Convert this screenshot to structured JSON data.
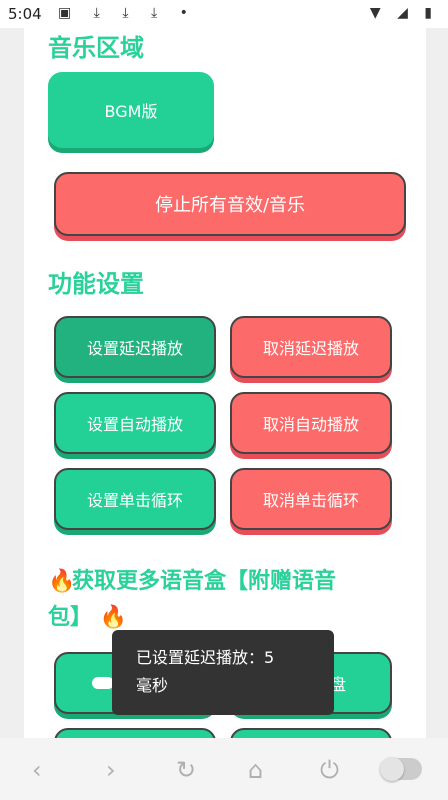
{
  "status_bar": {
    "time": "5:04",
    "left_icons": "▣ ⤓ ⤓ ⤓ •",
    "right_icons": "▼ ◢ ▮"
  },
  "music_section": {
    "title": "音乐区域",
    "bgm_button": "BGM版",
    "stop_button": "停止所有音效/音乐"
  },
  "settings_section": {
    "title": "功能设置",
    "buttons": [
      "设置延迟播放",
      "取消延迟播放",
      "设置自动播放",
      "取消自动播放",
      "设置单击循环",
      "取消单击循环"
    ]
  },
  "more_section": {
    "title_line1": "获取更多语音盒【附赠语音",
    "title_line2": "包】",
    "fire_icon": "🔥",
    "partial_button_right": "盘"
  },
  "toast": {
    "line1": "已设置延迟播放：5",
    "line2": "毫秒"
  },
  "nav": {
    "back_icon": "‹",
    "forward_icon": "›",
    "refresh_icon": "↻",
    "home_icon": "⌂",
    "power_icon": "⏻"
  },
  "colors": {
    "accent": "#2bd19a",
    "green": "#23d095",
    "red": "#fd6a6a",
    "toast": "#333333"
  }
}
